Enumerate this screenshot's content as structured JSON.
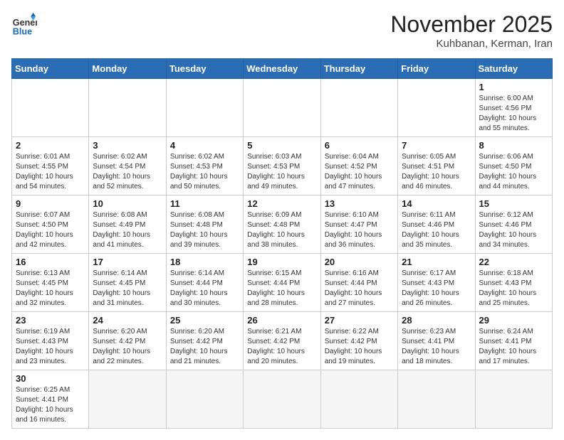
{
  "header": {
    "logo_general": "General",
    "logo_blue": "Blue",
    "month_title": "November 2025",
    "location": "Kuhbanan, Kerman, Iran"
  },
  "days_of_week": [
    "Sunday",
    "Monday",
    "Tuesday",
    "Wednesday",
    "Thursday",
    "Friday",
    "Saturday"
  ],
  "weeks": [
    [
      {
        "day": "",
        "info": ""
      },
      {
        "day": "",
        "info": ""
      },
      {
        "day": "",
        "info": ""
      },
      {
        "day": "",
        "info": ""
      },
      {
        "day": "",
        "info": ""
      },
      {
        "day": "",
        "info": ""
      },
      {
        "day": "1",
        "info": "Sunrise: 6:00 AM\nSunset: 4:56 PM\nDaylight: 10 hours\nand 55 minutes."
      }
    ],
    [
      {
        "day": "2",
        "info": "Sunrise: 6:01 AM\nSunset: 4:55 PM\nDaylight: 10 hours\nand 54 minutes."
      },
      {
        "day": "3",
        "info": "Sunrise: 6:02 AM\nSunset: 4:54 PM\nDaylight: 10 hours\nand 52 minutes."
      },
      {
        "day": "4",
        "info": "Sunrise: 6:02 AM\nSunset: 4:53 PM\nDaylight: 10 hours\nand 50 minutes."
      },
      {
        "day": "5",
        "info": "Sunrise: 6:03 AM\nSunset: 4:53 PM\nDaylight: 10 hours\nand 49 minutes."
      },
      {
        "day": "6",
        "info": "Sunrise: 6:04 AM\nSunset: 4:52 PM\nDaylight: 10 hours\nand 47 minutes."
      },
      {
        "day": "7",
        "info": "Sunrise: 6:05 AM\nSunset: 4:51 PM\nDaylight: 10 hours\nand 46 minutes."
      },
      {
        "day": "8",
        "info": "Sunrise: 6:06 AM\nSunset: 4:50 PM\nDaylight: 10 hours\nand 44 minutes."
      }
    ],
    [
      {
        "day": "9",
        "info": "Sunrise: 6:07 AM\nSunset: 4:50 PM\nDaylight: 10 hours\nand 42 minutes."
      },
      {
        "day": "10",
        "info": "Sunrise: 6:08 AM\nSunset: 4:49 PM\nDaylight: 10 hours\nand 41 minutes."
      },
      {
        "day": "11",
        "info": "Sunrise: 6:08 AM\nSunset: 4:48 PM\nDaylight: 10 hours\nand 39 minutes."
      },
      {
        "day": "12",
        "info": "Sunrise: 6:09 AM\nSunset: 4:48 PM\nDaylight: 10 hours\nand 38 minutes."
      },
      {
        "day": "13",
        "info": "Sunrise: 6:10 AM\nSunset: 4:47 PM\nDaylight: 10 hours\nand 36 minutes."
      },
      {
        "day": "14",
        "info": "Sunrise: 6:11 AM\nSunset: 4:46 PM\nDaylight: 10 hours\nand 35 minutes."
      },
      {
        "day": "15",
        "info": "Sunrise: 6:12 AM\nSunset: 4:46 PM\nDaylight: 10 hours\nand 34 minutes."
      }
    ],
    [
      {
        "day": "16",
        "info": "Sunrise: 6:13 AM\nSunset: 4:45 PM\nDaylight: 10 hours\nand 32 minutes."
      },
      {
        "day": "17",
        "info": "Sunrise: 6:14 AM\nSunset: 4:45 PM\nDaylight: 10 hours\nand 31 minutes."
      },
      {
        "day": "18",
        "info": "Sunrise: 6:14 AM\nSunset: 4:44 PM\nDaylight: 10 hours\nand 30 minutes."
      },
      {
        "day": "19",
        "info": "Sunrise: 6:15 AM\nSunset: 4:44 PM\nDaylight: 10 hours\nand 28 minutes."
      },
      {
        "day": "20",
        "info": "Sunrise: 6:16 AM\nSunset: 4:44 PM\nDaylight: 10 hours\nand 27 minutes."
      },
      {
        "day": "21",
        "info": "Sunrise: 6:17 AM\nSunset: 4:43 PM\nDaylight: 10 hours\nand 26 minutes."
      },
      {
        "day": "22",
        "info": "Sunrise: 6:18 AM\nSunset: 4:43 PM\nDaylight: 10 hours\nand 25 minutes."
      }
    ],
    [
      {
        "day": "23",
        "info": "Sunrise: 6:19 AM\nSunset: 4:43 PM\nDaylight: 10 hours\nand 23 minutes."
      },
      {
        "day": "24",
        "info": "Sunrise: 6:20 AM\nSunset: 4:42 PM\nDaylight: 10 hours\nand 22 minutes."
      },
      {
        "day": "25",
        "info": "Sunrise: 6:20 AM\nSunset: 4:42 PM\nDaylight: 10 hours\nand 21 minutes."
      },
      {
        "day": "26",
        "info": "Sunrise: 6:21 AM\nSunset: 4:42 PM\nDaylight: 10 hours\nand 20 minutes."
      },
      {
        "day": "27",
        "info": "Sunrise: 6:22 AM\nSunset: 4:42 PM\nDaylight: 10 hours\nand 19 minutes."
      },
      {
        "day": "28",
        "info": "Sunrise: 6:23 AM\nSunset: 4:41 PM\nDaylight: 10 hours\nand 18 minutes."
      },
      {
        "day": "29",
        "info": "Sunrise: 6:24 AM\nSunset: 4:41 PM\nDaylight: 10 hours\nand 17 minutes."
      }
    ],
    [
      {
        "day": "30",
        "info": "Sunrise: 6:25 AM\nSunset: 4:41 PM\nDaylight: 10 hours\nand 16 minutes."
      },
      {
        "day": "",
        "info": ""
      },
      {
        "day": "",
        "info": ""
      },
      {
        "day": "",
        "info": ""
      },
      {
        "day": "",
        "info": ""
      },
      {
        "day": "",
        "info": ""
      },
      {
        "day": "",
        "info": ""
      }
    ]
  ]
}
